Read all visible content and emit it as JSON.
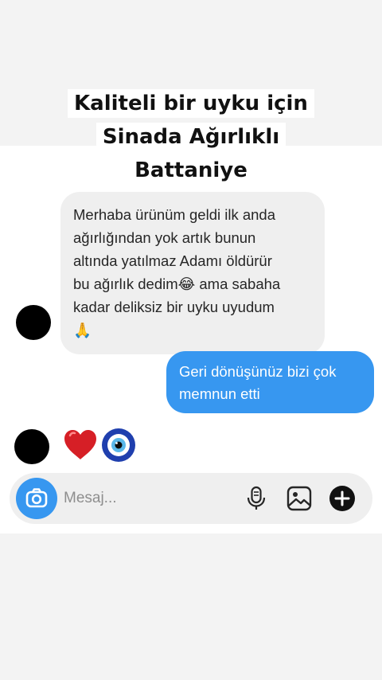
{
  "headline": {
    "line1": "Kaliteli bir uyku için",
    "line2": "Sinada Ağırlıklı",
    "line3": "Battaniye"
  },
  "messages": {
    "incoming": {
      "line1": "Merhaba ürünüm geldi ilk anda",
      "line2": "ağırlığından yok artık bunun",
      "line3": "altında yatılmaz Adamı öldürür",
      "line4a": "bu ağırlık dedim",
      "emoji_laugh": "😂",
      "line4b": " ama sabaha",
      "line5": "kadar deliksiz bir uyku uyudum",
      "emoji_pray": "🙏"
    },
    "outgoing": {
      "line1": "Geri dönüşünüz bizi çok",
      "line2": "memnun etti"
    }
  },
  "reactions": [
    "heart",
    "nazar-eye"
  ],
  "composer": {
    "placeholder": "Mesaj..."
  },
  "icons": {
    "camera": "camera-icon",
    "mic": "microphone-icon",
    "gallery": "image-icon",
    "add": "plus-icon"
  },
  "colors": {
    "accent_blue": "#3797f0",
    "incoming_bubble": "#efefef",
    "heart_red": "#d61f26",
    "nazar_blue": "#1f3fae"
  }
}
